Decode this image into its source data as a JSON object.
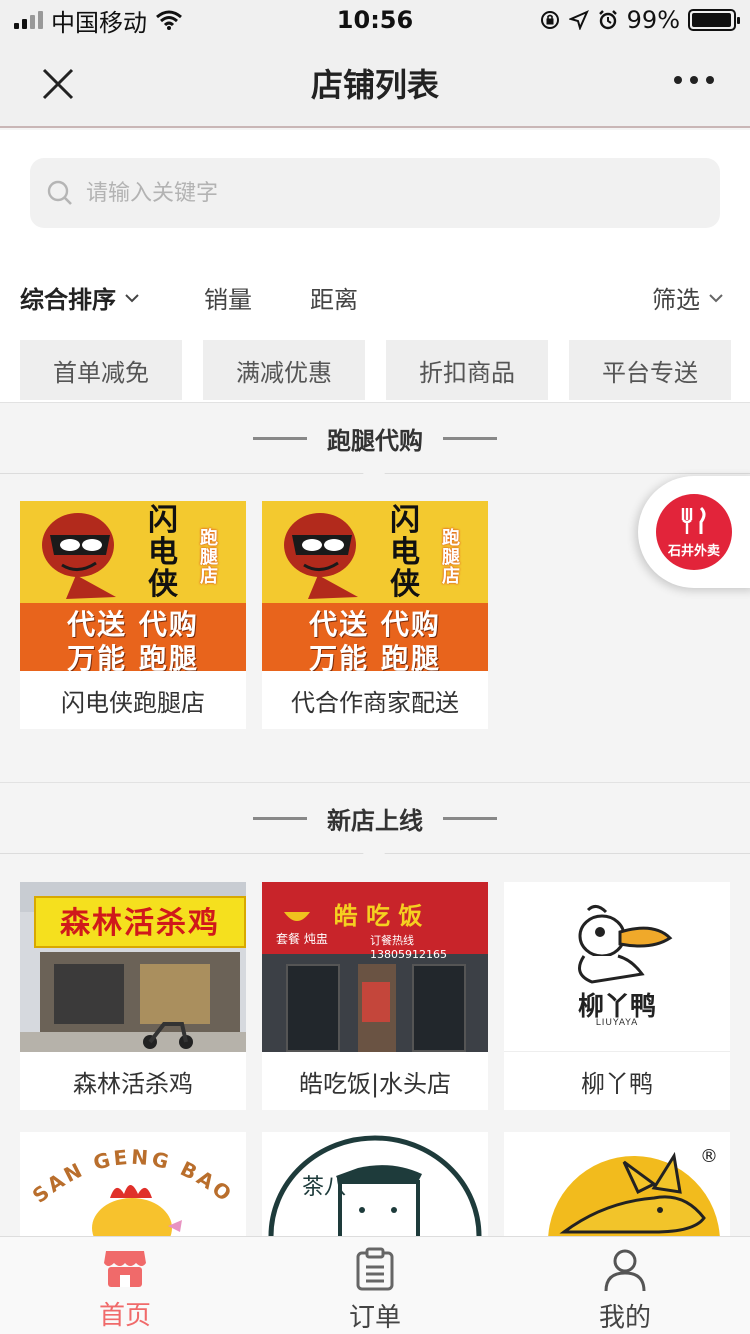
{
  "status_bar": {
    "carrier": "中国移动",
    "time": "10:56",
    "battery": "99%"
  },
  "nav": {
    "title": "店铺列表"
  },
  "search": {
    "placeholder": "请输入关键字"
  },
  "sort": {
    "default": "综合排序",
    "sales": "销量",
    "distance": "距离",
    "filter": "筛选"
  },
  "tags": [
    "首单减免",
    "满减优惠",
    "折扣商品",
    "平台专送"
  ],
  "sections": {
    "errand": {
      "title": "跑腿代购",
      "shops": [
        {
          "name": "闪电侠跑腿店",
          "img_big": [
            "闪",
            "电",
            "侠"
          ],
          "img_small": "跑腿店",
          "img_row1": "代送 代购",
          "img_row2": "万能 跑腿"
        },
        {
          "name": "代合作商家配送",
          "img_big": [
            "闪",
            "电",
            "侠"
          ],
          "img_small": "跑腿店",
          "img_row1": "代送 代购",
          "img_row2": "万能 跑腿"
        }
      ]
    },
    "new": {
      "title": "新店上线",
      "shops": [
        {
          "name": "森林活杀鸡",
          "sign": "森林活杀鸡"
        },
        {
          "name": "皓吃饭|水头店",
          "sign": "皓  吃  饭",
          "sign_sub": "套餐  炖盅",
          "sign_phone": "订餐热线 13805912165"
        },
        {
          "name": "柳丫鸭",
          "logo_text": "柳丫鸭",
          "logo_sub": "LIUYAYA"
        }
      ],
      "partial_logos": {
        "sangengbao": "SAN GENG BAO",
        "tea": "茶八",
        "registered": "®"
      }
    }
  },
  "float_badge": {
    "text": "石井外卖"
  },
  "tabs": [
    {
      "label": "首页",
      "icon": "shop-icon",
      "active": true
    },
    {
      "label": "订单",
      "icon": "order-icon",
      "active": false
    },
    {
      "label": "我的",
      "icon": "user-icon",
      "active": false
    }
  ],
  "colors": {
    "accent": "#f06a6a",
    "badge": "#e2243a",
    "promo_yellow": "#f3c92f",
    "promo_orange": "#e8641c"
  }
}
